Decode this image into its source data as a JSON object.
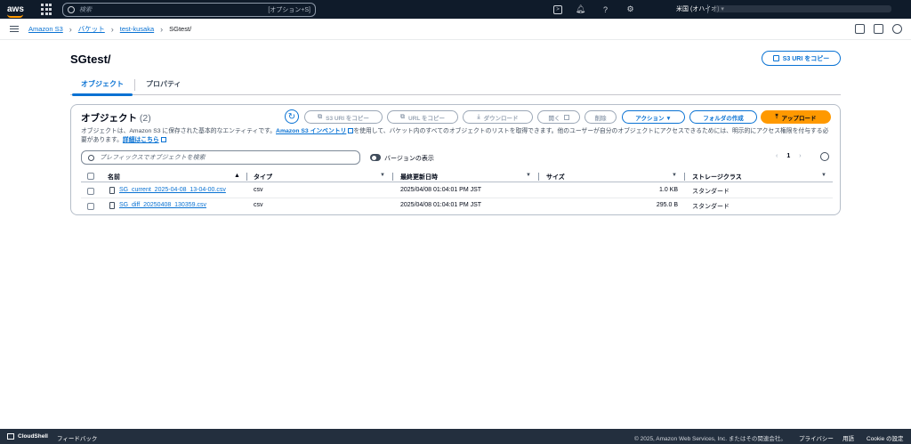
{
  "topbar": {
    "search_placeholder": "検索",
    "search_shortcut": "[オプション+S]",
    "region": "米国 (オハイオ) ▾"
  },
  "breadcrumb": {
    "items": [
      "Amazon S3",
      "バケット",
      "test-kusaka"
    ],
    "current": "SGtest/"
  },
  "page": {
    "title": "SGtest/",
    "copy_uri_label": "S3 URI をコピー"
  },
  "tabs": [
    {
      "label": "オブジェクト",
      "active": true
    },
    {
      "label": "プロパティ",
      "active": false
    }
  ],
  "objects_panel": {
    "title": "オブジェクト",
    "count": "(2)",
    "buttons": {
      "copy_s3_uri": "S3 URI をコピー",
      "copy_url": "URL をコピー",
      "download": "ダウンロード",
      "open": "開く",
      "delete": "削除",
      "actions": "アクション ▼",
      "create_folder": "フォルダの作成",
      "upload": "アップロード"
    },
    "description_part1": "オブジェクトは、Amazon S3 に保存された基本的なエンティティです。",
    "description_link1": "Amazon S3 インベントリ",
    "description_part2": "を使用して、バケット内のすべてのオブジェクトのリストを取得できます。他のユーザーが自分のオブジェクトにアクセスできるためには、明示的にアクセス権限を付与する必要があります。",
    "description_link2": "詳細はこちら",
    "search_placeholder": "プレフィックスでオブジェクトを検索",
    "versions_toggle_label": "バージョンの表示",
    "page_number": "1",
    "columns": [
      "名前",
      "タイプ",
      "最終更新日時",
      "サイズ",
      "ストレージクラス"
    ],
    "rows": [
      {
        "name": "SG_current_2025-04-08_13-04-00.csv",
        "type": "csv",
        "modified": "2025/04/08 01:04:01 PM JST",
        "size": "1.0 KB",
        "storage": "スタンダード"
      },
      {
        "name": "SG_diff_20250408_130359.csv",
        "type": "csv",
        "modified": "2025/04/08 01:04:01 PM JST",
        "size": "295.0 B",
        "storage": "スタンダード"
      }
    ]
  },
  "footer": {
    "cloudshell": "CloudShell",
    "feedback": "フィードバック",
    "copyright": "© 2025, Amazon Web Services, Inc. またはその関連会社。",
    "privacy": "プライバシー",
    "terms": "用語",
    "cookie": "Cookie の設定"
  }
}
